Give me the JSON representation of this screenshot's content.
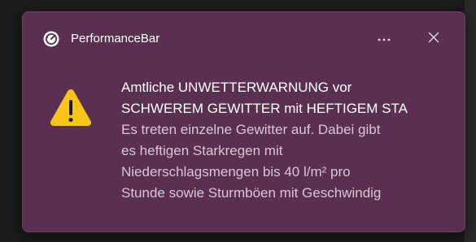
{
  "notification": {
    "app_name": "PerformanceBar",
    "app_icon": "gauge-icon",
    "more_icon": "more-horizontal-icon",
    "close_icon": "close-icon",
    "alert_icon": "warning-icon",
    "title_lines": [
      "Amtliche UNWETTERWARNUNG vor",
      "SCHWEREM GEWITTER mit HEFTIGEM STA"
    ],
    "body_lines": [
      "Es treten einzelne Gewitter auf. Dabei gibt",
      "es heftigen Starkregen mit",
      "Niederschlagsmengen bis 40 l/m² pro",
      "Stunde sowie Sturmböen mit Geschwindig"
    ],
    "colors": {
      "background": "#5b2f52",
      "title_text": "#ffffff",
      "body_text": "#d9c6d4",
      "warning_fill": "#f5c518"
    }
  }
}
